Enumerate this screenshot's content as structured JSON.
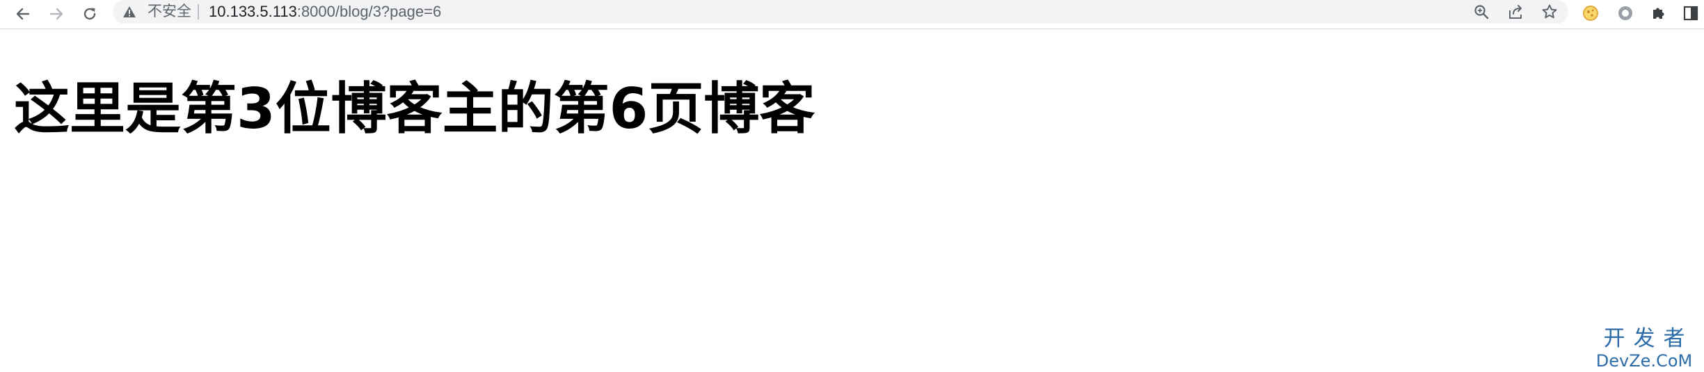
{
  "browser": {
    "security_label": "不安全",
    "url_host": "10.133.5.113",
    "url_rest": ":8000/blog/3?page=6",
    "icons": {
      "back": "arrow-left-icon",
      "forward": "arrow-right-icon",
      "reload": "reload-icon",
      "warning": "warning-triangle-icon",
      "zoom": "zoom-icon",
      "share": "share-icon",
      "bookmark": "star-icon",
      "extension_1": "cookie-extension-icon",
      "extension_2": "circle-extension-icon",
      "extensions": "puzzle-icon",
      "side_panel": "side-panel-icon"
    }
  },
  "page": {
    "heading": "这里是第3位博客主的第6页博客"
  },
  "watermark": {
    "line1": "开发者",
    "line2": "DevZe.CoM",
    "color": "#2c6ca8"
  }
}
